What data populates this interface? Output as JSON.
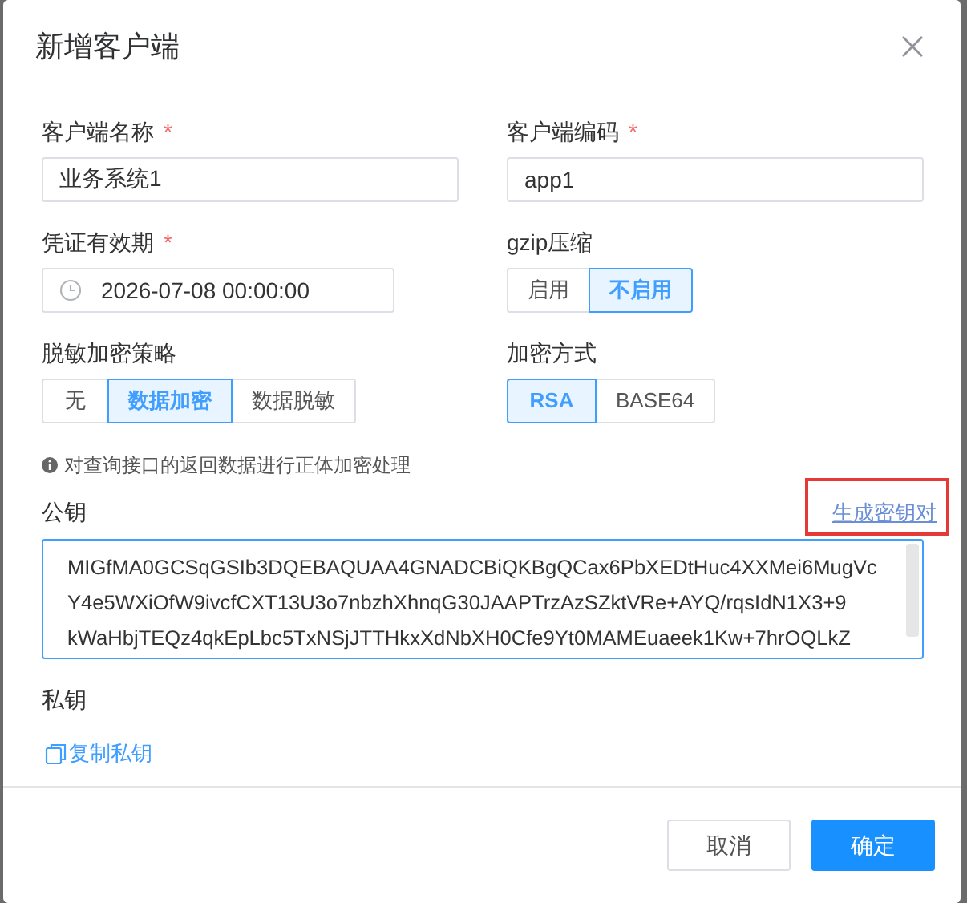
{
  "dialog": {
    "title": "新增客户端"
  },
  "fields": [
    {
      "kind": "input",
      "label": "客户端名称",
      "required_mark": "*",
      "value": "业务系统1"
    },
    {
      "kind": "input",
      "label": "客户端编码",
      "required_mark": "*",
      "value": "app1"
    },
    {
      "kind": "date",
      "label": "凭证有效期",
      "required_mark": "*",
      "value": "2026-07-08 00:00:00"
    },
    {
      "kind": "segmented",
      "label": "gzip压缩",
      "options": [
        {
          "label": "启用",
          "selected": false
        },
        {
          "label": "不启用",
          "selected": true
        }
      ]
    },
    {
      "kind": "segmented",
      "label": "脱敏加密策略",
      "options": [
        {
          "label": "无",
          "selected": false
        },
        {
          "label": "数据加密",
          "selected": true
        },
        {
          "label": "数据脱敏",
          "selected": false
        }
      ]
    },
    {
      "kind": "segmented",
      "label": "加密方式",
      "options": [
        {
          "label": "RSA",
          "selected": true
        },
        {
          "label": "BASE64",
          "selected": false
        }
      ]
    }
  ],
  "hint": "对查询接口的返回数据进行正体加密处理",
  "public_key": {
    "label": "公钥",
    "action": "生成密钥对",
    "highlighted": true,
    "lines": [
      "MIGfMA0GCSqGSIb3DQEBAQUAA4GNADCBiQKBgQCax6PbXEDtHuc4XXMei6MugVc",
      "Y4e5WXiOfW9ivcfCXT13U3o7nbzhXhnqG30JAAPTrzAzSZktVRe+AYQ/rqsIdN1X3+9",
      "kWaHbjTEQz4qkEpLbc5TxNSjJTTHkxXdNbXH0Cfe9Yt0MAMEuaeek1Kw+7hrOQLkZ"
    ]
  },
  "private_key": {
    "label": "私钥",
    "action": "复制私钥"
  },
  "buttons": [
    {
      "label": "取消",
      "kind": "secondary"
    },
    {
      "label": "确定",
      "kind": "primary"
    }
  ]
}
